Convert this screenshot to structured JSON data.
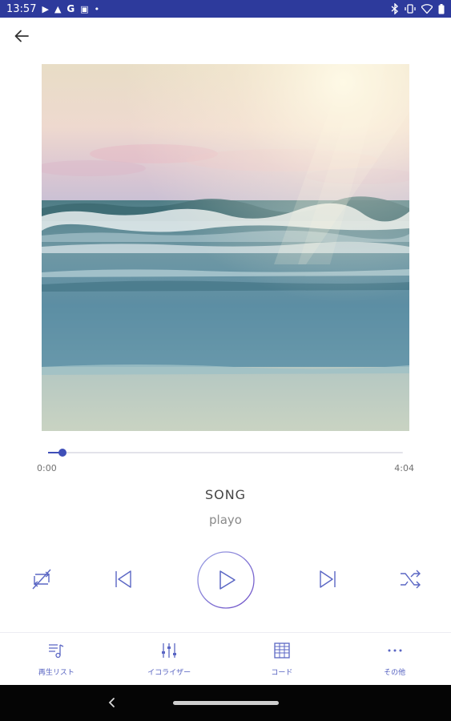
{
  "status_bar": {
    "time": "13:57",
    "left_icons": [
      "play-icon",
      "warning-icon",
      "google-icon",
      "image-icon",
      "dot-icon"
    ],
    "left_glyphs": [
      "▶",
      "▲",
      "G",
      "▣",
      "•"
    ],
    "right_icons": [
      "bluetooth-icon",
      "vibrate-icon",
      "wifi-icon",
      "battery-icon"
    ],
    "bar_color": "#2d3a9c"
  },
  "toolbar": {
    "back_icon": "arrow-left-icon"
  },
  "album": {
    "art_description_icon": "album-art-image"
  },
  "player": {
    "current_time": "0:00",
    "total_time": "4:04",
    "progress": 0.04,
    "title": "SONG",
    "artist": "playo",
    "accent_color": "#3f4fb8",
    "controls": [
      "repeat-off-icon",
      "skip-previous-icon",
      "play-icon",
      "skip-next-icon",
      "shuffle-icon"
    ]
  },
  "bottom_nav": {
    "items": [
      {
        "label": "再生リスト",
        "icon": "playlist-icon"
      },
      {
        "label": "イコライザー",
        "icon": "equalizer-icon"
      },
      {
        "label": "コード",
        "icon": "chord-grid-icon"
      },
      {
        "label": "その他",
        "icon": "more-icon"
      }
    ]
  },
  "system_nav": {
    "back_icon": "chevron-left-icon",
    "home_icon": "home-pill-icon"
  }
}
